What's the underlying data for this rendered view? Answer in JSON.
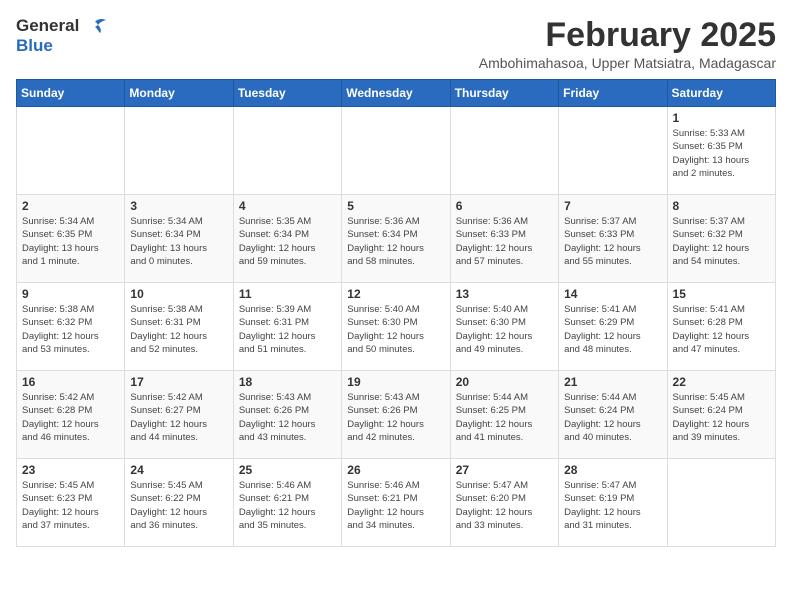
{
  "logo": {
    "line1": "General",
    "line2": "Blue"
  },
  "title": "February 2025",
  "subtitle": "Ambohimahasoa, Upper Matsiatra, Madagascar",
  "header": {
    "days": [
      "Sunday",
      "Monday",
      "Tuesday",
      "Wednesday",
      "Thursday",
      "Friday",
      "Saturday"
    ]
  },
  "weeks": [
    [
      {
        "day": "",
        "info": ""
      },
      {
        "day": "",
        "info": ""
      },
      {
        "day": "",
        "info": ""
      },
      {
        "day": "",
        "info": ""
      },
      {
        "day": "",
        "info": ""
      },
      {
        "day": "",
        "info": ""
      },
      {
        "day": "1",
        "info": "Sunrise: 5:33 AM\nSunset: 6:35 PM\nDaylight: 13 hours\nand 2 minutes."
      }
    ],
    [
      {
        "day": "2",
        "info": "Sunrise: 5:34 AM\nSunset: 6:35 PM\nDaylight: 13 hours\nand 1 minute."
      },
      {
        "day": "3",
        "info": "Sunrise: 5:34 AM\nSunset: 6:34 PM\nDaylight: 13 hours\nand 0 minutes."
      },
      {
        "day": "4",
        "info": "Sunrise: 5:35 AM\nSunset: 6:34 PM\nDaylight: 12 hours\nand 59 minutes."
      },
      {
        "day": "5",
        "info": "Sunrise: 5:36 AM\nSunset: 6:34 PM\nDaylight: 12 hours\nand 58 minutes."
      },
      {
        "day": "6",
        "info": "Sunrise: 5:36 AM\nSunset: 6:33 PM\nDaylight: 12 hours\nand 57 minutes."
      },
      {
        "day": "7",
        "info": "Sunrise: 5:37 AM\nSunset: 6:33 PM\nDaylight: 12 hours\nand 55 minutes."
      },
      {
        "day": "8",
        "info": "Sunrise: 5:37 AM\nSunset: 6:32 PM\nDaylight: 12 hours\nand 54 minutes."
      }
    ],
    [
      {
        "day": "9",
        "info": "Sunrise: 5:38 AM\nSunset: 6:32 PM\nDaylight: 12 hours\nand 53 minutes."
      },
      {
        "day": "10",
        "info": "Sunrise: 5:38 AM\nSunset: 6:31 PM\nDaylight: 12 hours\nand 52 minutes."
      },
      {
        "day": "11",
        "info": "Sunrise: 5:39 AM\nSunset: 6:31 PM\nDaylight: 12 hours\nand 51 minutes."
      },
      {
        "day": "12",
        "info": "Sunrise: 5:40 AM\nSunset: 6:30 PM\nDaylight: 12 hours\nand 50 minutes."
      },
      {
        "day": "13",
        "info": "Sunrise: 5:40 AM\nSunset: 6:30 PM\nDaylight: 12 hours\nand 49 minutes."
      },
      {
        "day": "14",
        "info": "Sunrise: 5:41 AM\nSunset: 6:29 PM\nDaylight: 12 hours\nand 48 minutes."
      },
      {
        "day": "15",
        "info": "Sunrise: 5:41 AM\nSunset: 6:28 PM\nDaylight: 12 hours\nand 47 minutes."
      }
    ],
    [
      {
        "day": "16",
        "info": "Sunrise: 5:42 AM\nSunset: 6:28 PM\nDaylight: 12 hours\nand 46 minutes."
      },
      {
        "day": "17",
        "info": "Sunrise: 5:42 AM\nSunset: 6:27 PM\nDaylight: 12 hours\nand 44 minutes."
      },
      {
        "day": "18",
        "info": "Sunrise: 5:43 AM\nSunset: 6:26 PM\nDaylight: 12 hours\nand 43 minutes."
      },
      {
        "day": "19",
        "info": "Sunrise: 5:43 AM\nSunset: 6:26 PM\nDaylight: 12 hours\nand 42 minutes."
      },
      {
        "day": "20",
        "info": "Sunrise: 5:44 AM\nSunset: 6:25 PM\nDaylight: 12 hours\nand 41 minutes."
      },
      {
        "day": "21",
        "info": "Sunrise: 5:44 AM\nSunset: 6:24 PM\nDaylight: 12 hours\nand 40 minutes."
      },
      {
        "day": "22",
        "info": "Sunrise: 5:45 AM\nSunset: 6:24 PM\nDaylight: 12 hours\nand 39 minutes."
      }
    ],
    [
      {
        "day": "23",
        "info": "Sunrise: 5:45 AM\nSunset: 6:23 PM\nDaylight: 12 hours\nand 37 minutes."
      },
      {
        "day": "24",
        "info": "Sunrise: 5:45 AM\nSunset: 6:22 PM\nDaylight: 12 hours\nand 36 minutes."
      },
      {
        "day": "25",
        "info": "Sunrise: 5:46 AM\nSunset: 6:21 PM\nDaylight: 12 hours\nand 35 minutes."
      },
      {
        "day": "26",
        "info": "Sunrise: 5:46 AM\nSunset: 6:21 PM\nDaylight: 12 hours\nand 34 minutes."
      },
      {
        "day": "27",
        "info": "Sunrise: 5:47 AM\nSunset: 6:20 PM\nDaylight: 12 hours\nand 33 minutes."
      },
      {
        "day": "28",
        "info": "Sunrise: 5:47 AM\nSunset: 6:19 PM\nDaylight: 12 hours\nand 31 minutes."
      },
      {
        "day": "",
        "info": ""
      }
    ]
  ]
}
